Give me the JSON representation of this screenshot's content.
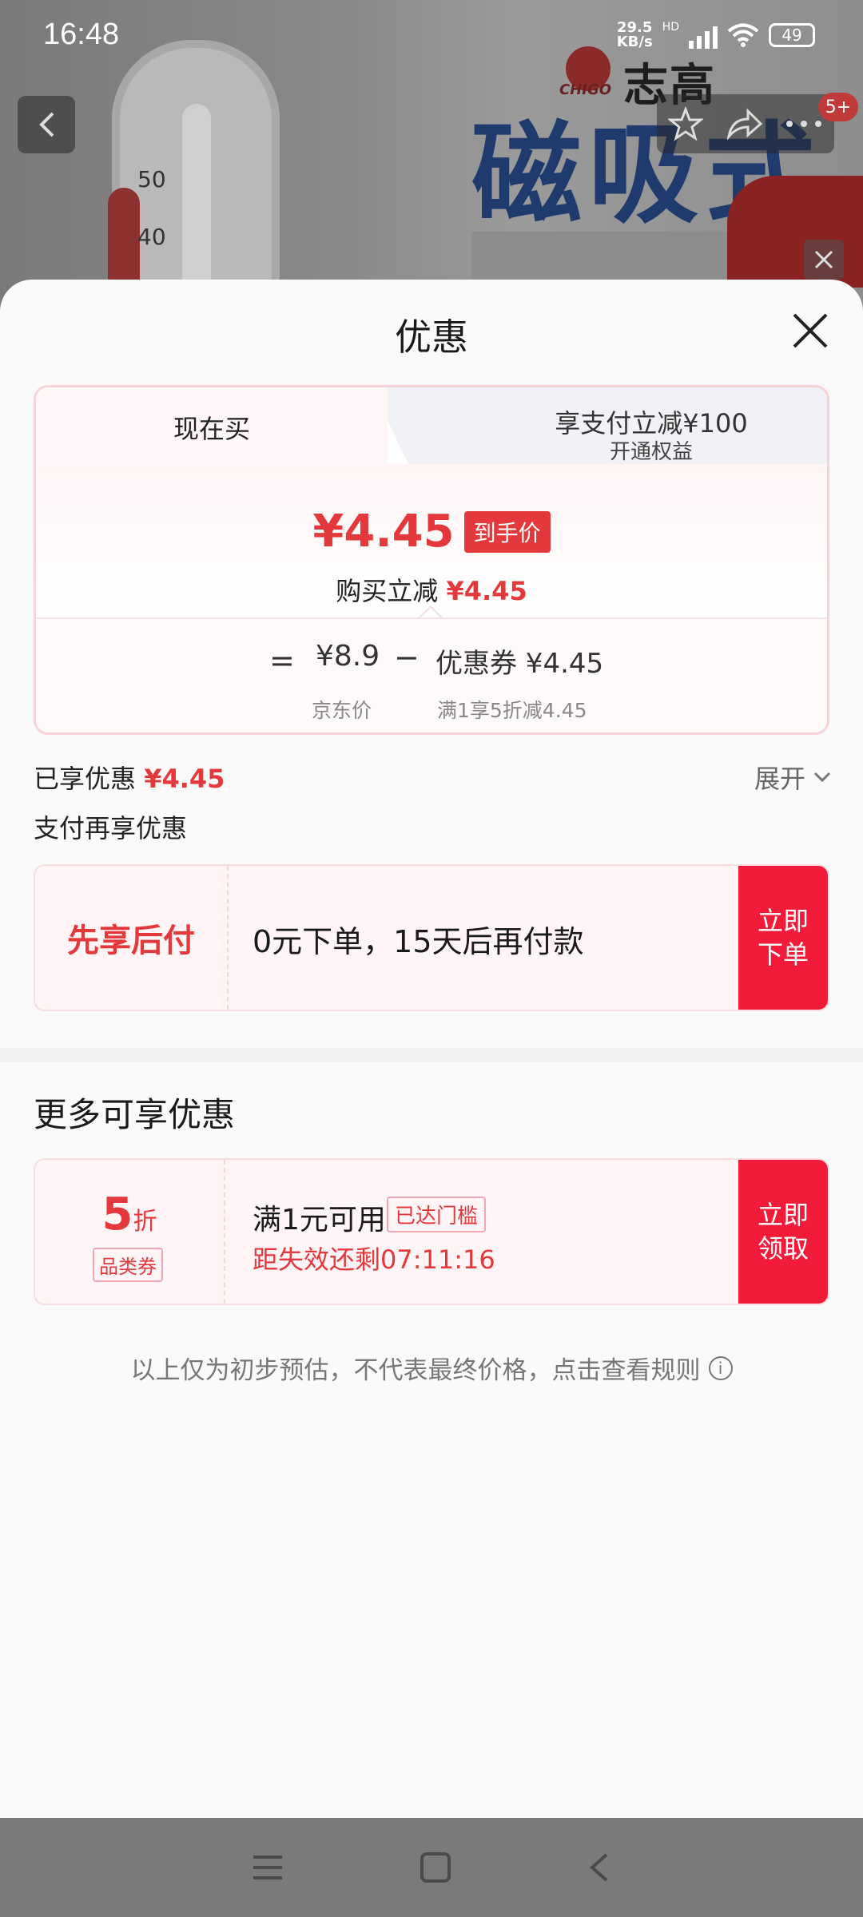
{
  "status_bar": {
    "time": "16:48",
    "net_speed": "29.5",
    "net_unit": "KB/s",
    "hd": "HD",
    "battery": "49"
  },
  "background": {
    "brand_name": "志高",
    "brand_sub": "CHIGO",
    "banner_title": "磁吸式",
    "thermo_labels": [
      "50",
      "40"
    ],
    "notification_badge": "5+"
  },
  "sheet": {
    "title": "优惠",
    "tabs": {
      "now": "现在买",
      "pay_main": "享支付立减¥100",
      "pay_sub": "开通权益"
    },
    "final_price": "¥4.45",
    "final_tag": "到手价",
    "reduce_label": "购买立减",
    "reduce_value": "¥4.45",
    "breakdown": {
      "eq": "=",
      "jd_price": "¥8.9",
      "minus": "−",
      "coupon_price": "优惠券 ¥4.45",
      "jd_label": "京东价",
      "coupon_label": "满1享5折减4.45"
    },
    "enjoyed_label": "已享优惠",
    "enjoyed_value": "¥4.45",
    "expand_label": "展开",
    "pay_again_label": "支付再享优惠",
    "bnpl": {
      "title": "先享后付",
      "text": "0元下单，15天后再付款",
      "button_line1": "立即",
      "button_line2": "下单"
    },
    "more_title": "更多可享优惠",
    "coupon": {
      "value": "5",
      "unit": "折",
      "type": "品类券",
      "condition": "满1元可用",
      "reached": "已达门槛",
      "timer": "距失效还剩07:11:16",
      "button_line1": "立即",
      "button_line2": "领取"
    },
    "disclaimer": "以上仅为初步预估，不代表最终价格，点击查看规则",
    "info_icon": "i"
  },
  "colors": {
    "accent_red": "#e4393c",
    "button_red": "#f21c3a"
  }
}
